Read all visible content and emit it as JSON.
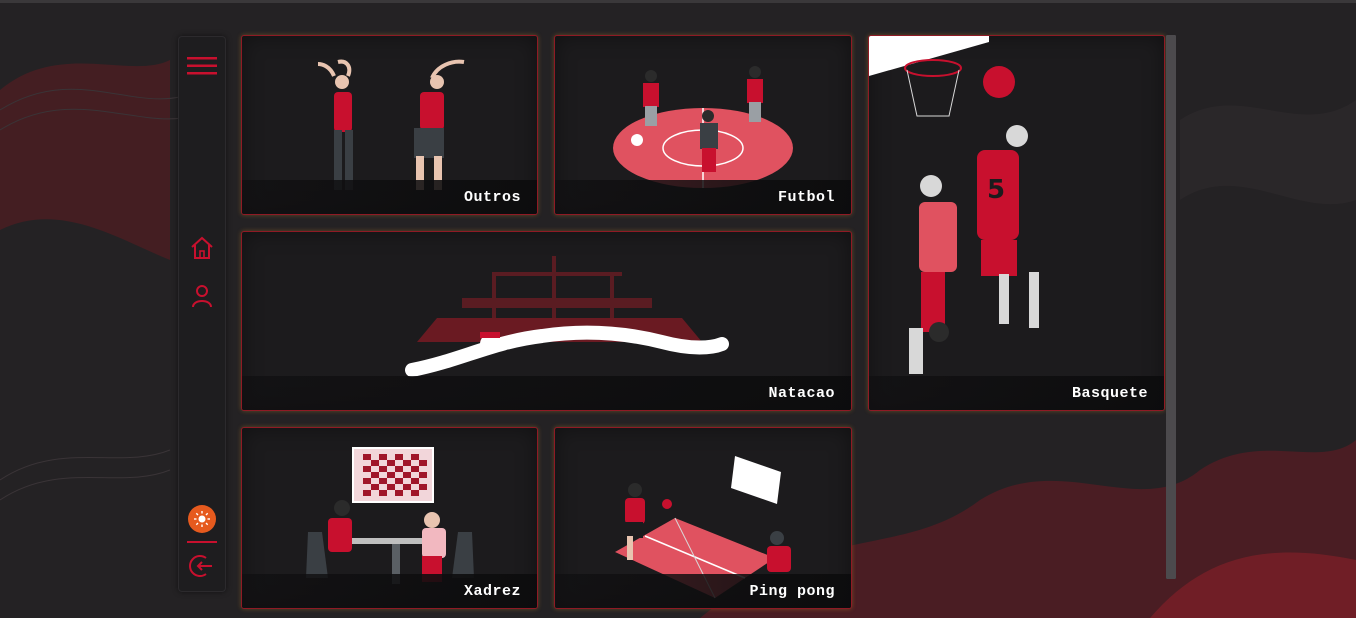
{
  "sidebar": {
    "menu_icon": "hamburger-menu-icon",
    "nav": [
      {
        "icon": "home-icon"
      },
      {
        "icon": "user-icon"
      }
    ],
    "theme_icon": "sun-icon",
    "logout_icon": "logout-icon"
  },
  "cards": {
    "outros": "Outros",
    "futbol": "Futbol",
    "basquete": "Basquete",
    "natacao": "Natacao",
    "xadrez": "Xadrez",
    "pingpong": "Ping pong"
  },
  "colors": {
    "accent": "#c8102e",
    "background": "#242224",
    "card": "#1c1b1d",
    "card_border": "#8f1a25",
    "theme_button": "#e65a1e"
  }
}
